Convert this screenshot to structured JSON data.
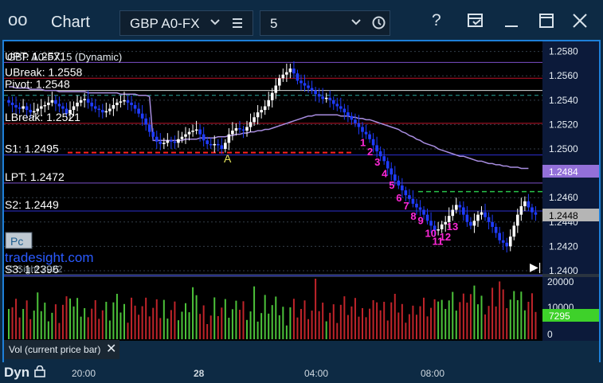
{
  "window": {
    "icon": "oo",
    "title": "Chart",
    "symbol": "GBP A0-FX",
    "interval": "5",
    "buttons": [
      "help-icon",
      "form-icon",
      "minimize-icon",
      "maximize-icon",
      "close-icon"
    ]
  },
  "chart_header": "GBP A0-FX, 5 (Dynamic)",
  "levels": [
    {
      "label": "UPT: 1.2571",
      "value": 1.2571,
      "color": "#7b4fc8"
    },
    {
      "label": "UBreak: 1.2558",
      "value": 1.2558,
      "color": "#c0142a"
    },
    {
      "label": "Pivot: 1.2548",
      "value": 1.2548,
      "color": "#d9d9d9"
    },
    {
      "label": "LBreak: 1.2521",
      "value": 1.2521,
      "color": "#c0142a"
    },
    {
      "label": "S1: 1.2495",
      "value": 1.2495,
      "color": "#2d2fd0"
    },
    {
      "label": "LPT: 1.2472",
      "value": 1.2472,
      "color": "#7b4fc8"
    },
    {
      "label": "S2: 1.2449",
      "value": 1.2449,
      "color": "#2d2fd0"
    },
    {
      "label": "S3: 1.2396",
      "value": 1.2396,
      "color": "#2d2fd0"
    }
  ],
  "badges": {
    "pc": "Pc",
    "brand": "tradesight.com",
    "copyright": "© Sight 2022",
    "marker_a": "A"
  },
  "price_axis": {
    "ticks": [
      "1.2580",
      "1.2560",
      "1.2540",
      "1.2520",
      "1.2500",
      "1.2460",
      "1.2440",
      "1.2420",
      "1.2400"
    ],
    "ma_label": "1.2484",
    "last_label": "1.2448"
  },
  "volume_axis": {
    "ticks": [
      "20000",
      "10000",
      "0"
    ],
    "last_label": "7295"
  },
  "volume_panel_title": "Vol (current price bar)",
  "footer": {
    "mode": "Dyn",
    "x_labels": [
      "20:00",
      "28",
      "04:00",
      "08:00"
    ]
  },
  "setup_counts": [
    "1",
    "2",
    "3",
    "4",
    "5",
    "6",
    "7",
    "8",
    "9",
    "10",
    "11",
    "12",
    "13"
  ],
  "colors": {
    "bull_candle": "#ffffff",
    "bear_candle": "#1f3cff",
    "ma_line": "#a88de0",
    "count_magenta": "#ff28d8",
    "count_green": "#28c24a",
    "volume_up": "#4cc23a",
    "volume_down": "#c0242a",
    "accent": "#1e7fd8"
  },
  "chart_data": {
    "type": "candlestick",
    "title": "GBP A0-FX, 5 (Dynamic)",
    "ylim": [
      1.24,
      1.2585
    ],
    "close": [
      1.2538,
      1.2536,
      1.2534,
      1.2533,
      1.2535,
      1.2532,
      1.253,
      1.2531,
      1.2533,
      1.2535,
      1.2536,
      1.2538,
      1.254,
      1.2537,
      1.2535,
      1.2533,
      1.2529,
      1.2532,
      1.2535,
      1.2538,
      1.254,
      1.2541,
      1.2538,
      1.2535,
      1.2533,
      1.2532,
      1.253,
      1.2531,
      1.2533,
      1.2536,
      1.2538,
      1.2539,
      1.254,
      1.2538,
      1.2536,
      1.2533,
      1.2529,
      1.2525,
      1.252,
      1.2514,
      1.251,
      1.2506,
      1.2504,
      1.2505,
      1.2507,
      1.2506,
      1.2505,
      1.2508,
      1.251,
      1.2512,
      1.2514,
      1.2515,
      1.2516,
      1.2512,
      1.2507,
      1.2504,
      1.2503,
      1.2504,
      1.2503,
      1.25,
      1.2505,
      1.2512,
      1.2515,
      1.2517,
      1.2516,
      1.2515,
      1.2518,
      1.2522,
      1.2526,
      1.253,
      1.2532,
      1.2535,
      1.254,
      1.2546,
      1.2552,
      1.2558,
      1.2561,
      1.2563,
      1.2566,
      1.2562,
      1.2556,
      1.2554,
      1.2552,
      1.255,
      1.2548,
      1.2545,
      1.2543,
      1.2541,
      1.2542,
      1.254,
      1.2537,
      1.2535,
      1.2533,
      1.253,
      1.2527,
      1.2524,
      1.2521,
      1.2518,
      1.2514,
      1.2512,
      1.2508,
      1.2503,
      1.2498,
      1.2494,
      1.249,
      1.2484,
      1.2479,
      1.2474,
      1.247,
      1.2466,
      1.2462,
      1.2459,
      1.2455,
      1.2452,
      1.245,
      1.2446,
      1.2441,
      1.2437,
      1.2433,
      1.2434,
      1.2438,
      1.244,
      1.2445,
      1.245,
      1.2454,
      1.2452,
      1.2446,
      1.244,
      1.2437,
      1.2441,
      1.2446,
      1.2448,
      1.2444,
      1.244,
      1.2436,
      1.2431,
      1.2425,
      1.2423,
      1.242,
      1.2428,
      1.2437,
      1.2446,
      1.2453,
      1.2457,
      1.2452,
      1.2448,
      1.2446
    ],
    "ma": [
      1.2551,
      1.2551,
      1.255,
      1.255,
      1.255,
      1.255,
      1.2549,
      1.2549,
      1.2549,
      1.2549,
      1.2548,
      1.2548,
      1.2548,
      1.2548,
      1.2547,
      1.2547,
      1.2547,
      1.2547,
      1.2547,
      1.2547,
      1.2547,
      1.2547,
      1.2546,
      1.2546,
      1.2546,
      1.2546,
      1.2546,
      1.2546,
      1.2546,
      1.2546,
      1.2546,
      1.2545,
      1.2545,
      1.2545,
      1.2545,
      1.2545,
      1.2544,
      1.2544,
      1.2544,
      1.2543,
      1.2507,
      1.2507,
      1.2507,
      1.2507,
      1.2507,
      1.2507,
      1.2507,
      1.2507,
      1.2507,
      1.2508,
      1.2508,
      1.2508,
      1.2508,
      1.2509,
      1.2509,
      1.2509,
      1.2509,
      1.2509,
      1.251,
      1.251,
      1.251,
      1.2511,
      1.2511,
      1.2512,
      1.2512,
      1.2513,
      1.2513,
      1.2514,
      1.2514,
      1.2515,
      1.2515,
      1.2516,
      1.2516,
      1.2517,
      1.2518,
      1.2519,
      1.252,
      1.2521,
      1.2522,
      1.2523,
      1.2524,
      1.2525,
      1.2526,
      1.2527,
      1.2527,
      1.2528,
      1.2528,
      1.2528,
      1.2528,
      1.2528,
      1.2528,
      1.2528,
      1.2527,
      1.2527,
      1.2527,
      1.2526,
      1.2526,
      1.2525,
      1.2525,
      1.2524,
      1.2524,
      1.2523,
      1.2522,
      1.2521,
      1.252,
      1.2519,
      1.2518,
      1.2517,
      1.2516,
      1.2514,
      1.2513,
      1.2511,
      1.251,
      1.2508,
      1.2507,
      1.2505,
      1.2504,
      1.2503,
      1.2502,
      1.25,
      1.2499,
      1.2498,
      1.2497,
      1.2496,
      1.2495,
      1.2494,
      1.2494,
      1.2493,
      1.2492,
      1.2491,
      1.249,
      1.249,
      1.2489,
      1.2488,
      1.2488,
      1.2487,
      1.2487,
      1.2486,
      1.2486,
      1.2485,
      1.2485,
      1.2485,
      1.2484,
      1.2484,
      1.2484
    ],
    "volume_ylim": [
      0,
      22000
    ]
  }
}
